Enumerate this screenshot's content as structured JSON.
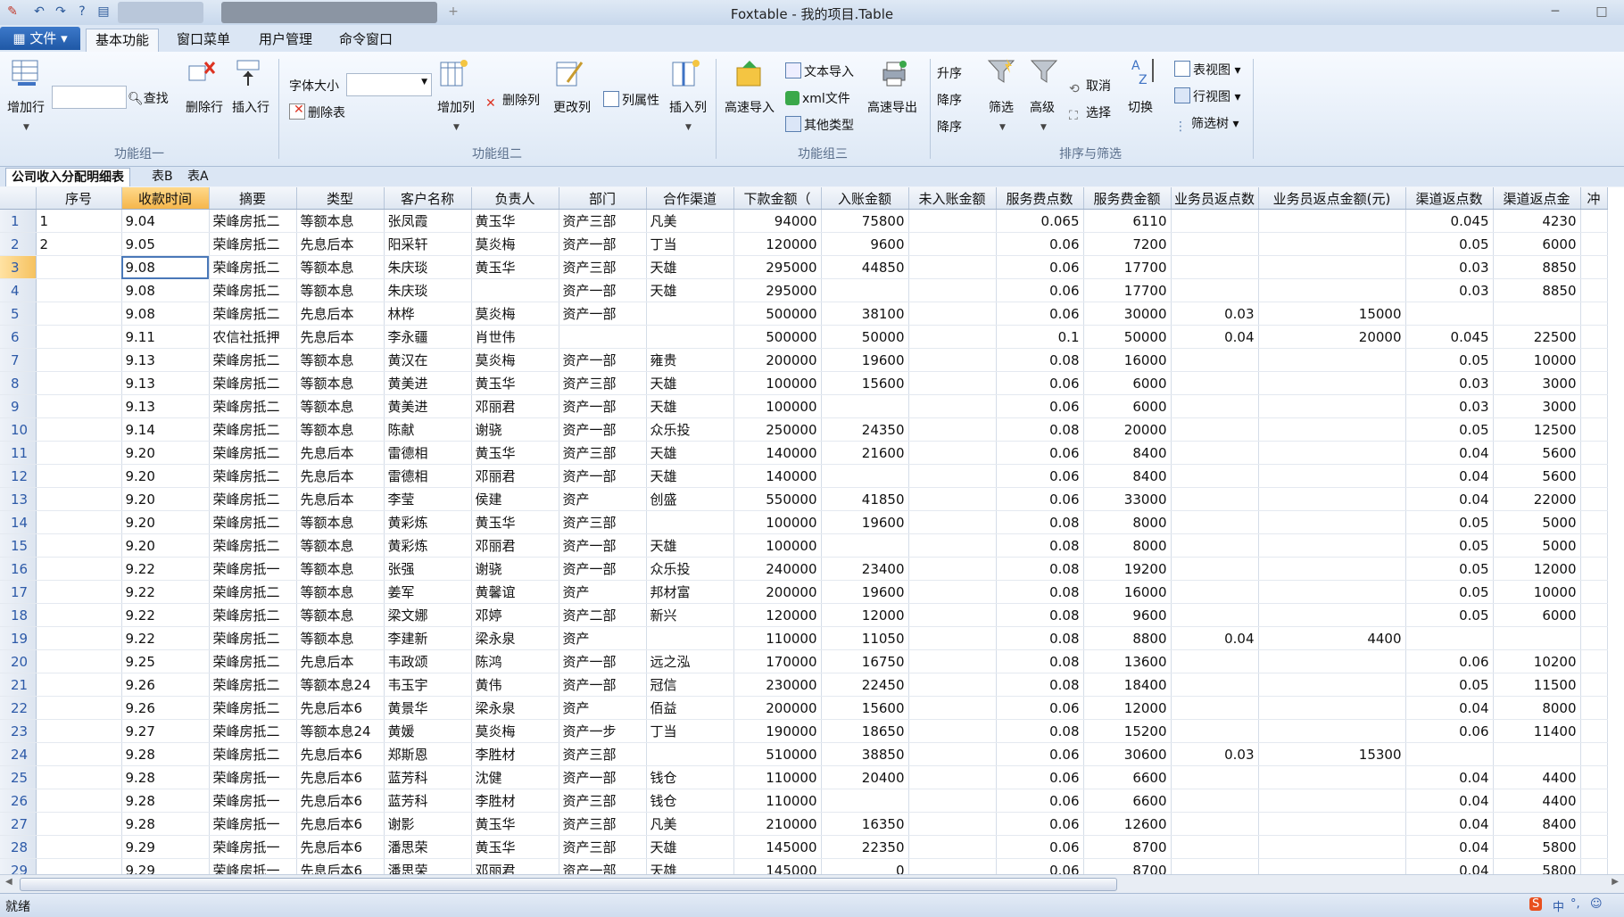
{
  "window": {
    "title": "Foxtable - 我的项目.Table"
  },
  "menu": {
    "file": "文件",
    "tabs": [
      "基本功能",
      "窗口菜单",
      "用户管理",
      "命令窗口"
    ]
  },
  "ribbon": {
    "group1": {
      "label": "功能组一",
      "add_row": "增加行",
      "search": "查找",
      "delete_row": "删除行",
      "insert_row": "插入行"
    },
    "group2": {
      "label": "功能组二",
      "font_size": "字体大小",
      "delete_table": "删除表",
      "add_col": "增加列",
      "delete_col": "删除列",
      "change_col": "更改列",
      "col_props": "列属性",
      "insert_col": "插入列"
    },
    "group3": {
      "label": "功能组三",
      "fast_import": "高速导入",
      "text_import": "文本导入",
      "xml_file": "xml文件",
      "other_types": "其他类型",
      "fast_export": "高速导出"
    },
    "group4": {
      "label": "排序与筛选",
      "asc": "升序",
      "desc1": "降序",
      "desc2": "降序",
      "filter": "筛选",
      "advanced": "高级",
      "cancel": "取消",
      "select": "选择",
      "switch": "切换",
      "table_view": "表视图",
      "row_view": "行视图",
      "filter_tree": "筛选树"
    }
  },
  "sheet_tabs": [
    "公司收入分配明细表",
    "表B",
    "表A"
  ],
  "columns": [
    "序号",
    "收款时间",
    "摘要",
    "类型",
    "客户名称",
    "负责人",
    "部门",
    "合作渠道",
    "下款金额（",
    "入账金额",
    "未入账金额",
    "服务费点数",
    "服务费金额",
    "业务员返点数",
    "业务员返点金额(元)",
    "渠道返点数",
    "渠道返点金",
    "冲"
  ],
  "rows": [
    [
      "1",
      "9.04",
      "荣峰房抵二",
      "等额本息",
      "张凤霞",
      "黄玉华",
      "资产三部",
      "凡美",
      "94000",
      "75800",
      "",
      "0.065",
      "6110",
      "",
      "",
      "0.045",
      "4230",
      ""
    ],
    [
      "2",
      "9.05",
      "荣峰房抵二",
      "先息后本",
      "阳采轩",
      "莫炎梅",
      "资产一部",
      "丁当",
      "120000",
      "9600",
      "",
      "0.06",
      "7200",
      "",
      "",
      "0.05",
      "6000",
      ""
    ],
    [
      "",
      "9.08",
      "荣峰房抵二",
      "等额本息",
      "朱庆琰",
      "黄玉华",
      "资产三部",
      "天雄",
      "295000",
      "44850",
      "",
      "0.06",
      "17700",
      "",
      "",
      "0.03",
      "8850",
      ""
    ],
    [
      "",
      "9.08",
      "荣峰房抵二",
      "等额本息",
      "朱庆琰",
      "",
      "资产一部",
      "天雄",
      "295000",
      "",
      "",
      "0.06",
      "17700",
      "",
      "",
      "0.03",
      "8850",
      ""
    ],
    [
      "",
      "9.08",
      "荣峰房抵二",
      "先息后本",
      "林桦",
      "莫炎梅",
      "资产一部",
      "",
      "500000",
      "38100",
      "",
      "0.06",
      "30000",
      "0.03",
      "15000",
      "",
      "",
      ""
    ],
    [
      "",
      "9.11",
      "农信社抵押",
      "先息后本",
      "李永疆",
      "肖世伟",
      "",
      "",
      "500000",
      "50000",
      "",
      "0.1",
      "50000",
      "0.04",
      "20000",
      "0.045",
      "22500",
      ""
    ],
    [
      "",
      "9.13",
      "荣峰房抵二",
      "等额本息",
      "黄汉在",
      "莫炎梅",
      "资产一部",
      "雍贵",
      "200000",
      "19600",
      "",
      "0.08",
      "16000",
      "",
      "",
      "0.05",
      "10000",
      ""
    ],
    [
      "",
      "9.13",
      "荣峰房抵二",
      "等额本息",
      "黄美进",
      "黄玉华",
      "资产三部",
      "天雄",
      "100000",
      "15600",
      "",
      "0.06",
      "6000",
      "",
      "",
      "0.03",
      "3000",
      ""
    ],
    [
      "",
      "9.13",
      "荣峰房抵二",
      "等额本息",
      "黄美进",
      "邓丽君",
      "资产一部",
      "天雄",
      "100000",
      "",
      "",
      "0.06",
      "6000",
      "",
      "",
      "0.03",
      "3000",
      ""
    ],
    [
      "",
      "9.14",
      "荣峰房抵二",
      "等额本息",
      "陈献",
      "谢骁",
      "资产一部",
      "众乐投",
      "250000",
      "24350",
      "",
      "0.08",
      "20000",
      "",
      "",
      "0.05",
      "12500",
      ""
    ],
    [
      "",
      "9.20",
      "荣峰房抵二",
      "先息后本",
      "雷德相",
      "黄玉华",
      "资产三部",
      "天雄",
      "140000",
      "21600",
      "",
      "0.06",
      "8400",
      "",
      "",
      "0.04",
      "5600",
      ""
    ],
    [
      "",
      "9.20",
      "荣峰房抵二",
      "先息后本",
      "雷德相",
      "邓丽君",
      "资产一部",
      "天雄",
      "140000",
      "",
      "",
      "0.06",
      "8400",
      "",
      "",
      "0.04",
      "5600",
      ""
    ],
    [
      "",
      "9.20",
      "荣峰房抵二",
      "先息后本",
      "李莹",
      "侯建",
      "资产",
      "创盛",
      "550000",
      "41850",
      "",
      "0.06",
      "33000",
      "",
      "",
      "0.04",
      "22000",
      ""
    ],
    [
      "",
      "9.20",
      "荣峰房抵二",
      "等额本息",
      "黄彩炼",
      "黄玉华",
      "资产三部",
      "",
      "100000",
      "19600",
      "",
      "0.08",
      "8000",
      "",
      "",
      "0.05",
      "5000",
      ""
    ],
    [
      "",
      "9.20",
      "荣峰房抵二",
      "等额本息",
      "黄彩炼",
      "邓丽君",
      "资产一部",
      "天雄",
      "100000",
      "",
      "",
      "0.08",
      "8000",
      "",
      "",
      "0.05",
      "5000",
      ""
    ],
    [
      "",
      "9.22",
      "荣峰房抵一",
      "等额本息",
      "张强",
      "谢骁",
      "资产一部",
      "众乐投",
      "240000",
      "23400",
      "",
      "0.08",
      "19200",
      "",
      "",
      "0.05",
      "12000",
      ""
    ],
    [
      "",
      "9.22",
      "荣峰房抵二",
      "等额本息",
      "姜军",
      "黄馨谊",
      "资产",
      "邦材富",
      "200000",
      "19600",
      "",
      "0.08",
      "16000",
      "",
      "",
      "0.05",
      "10000",
      ""
    ],
    [
      "",
      "9.22",
      "荣峰房抵二",
      "等额本息",
      "梁文娜",
      "邓婷",
      "资产二部",
      "新兴",
      "120000",
      "12000",
      "",
      "0.08",
      "9600",
      "",
      "",
      "0.05",
      "6000",
      ""
    ],
    [
      "",
      "9.22",
      "荣峰房抵二",
      "等额本息",
      "李建新",
      "梁永泉",
      "资产",
      "",
      "110000",
      "11050",
      "",
      "0.08",
      "8800",
      "0.04",
      "4400",
      "",
      "",
      ""
    ],
    [
      "",
      "9.25",
      "荣峰房抵二",
      "先息后本",
      "韦政颂",
      "陈鸿",
      "资产一部",
      "远之泓",
      "170000",
      "16750",
      "",
      "0.08",
      "13600",
      "",
      "",
      "0.06",
      "10200",
      ""
    ],
    [
      "",
      "9.26",
      "荣峰房抵二",
      "等额本息24",
      "韦玉宇",
      "黄伟",
      "资产一部",
      "冠信",
      "230000",
      "22450",
      "",
      "0.08",
      "18400",
      "",
      "",
      "0.05",
      "11500",
      ""
    ],
    [
      "",
      "9.26",
      "荣峰房抵二",
      "先息后本6",
      "黄景华",
      "梁永泉",
      "资产",
      "佰益",
      "200000",
      "15600",
      "",
      "0.06",
      "12000",
      "",
      "",
      "0.04",
      "8000",
      ""
    ],
    [
      "",
      "9.27",
      "荣峰房抵二",
      "等额本息24",
      "黄媛",
      "莫炎梅",
      "资产一步",
      "丁当",
      "190000",
      "18650",
      "",
      "0.08",
      "15200",
      "",
      "",
      "0.06",
      "11400",
      ""
    ],
    [
      "",
      "9.28",
      "荣峰房抵二",
      "先息后本6",
      "郑斯恩",
      "李胜材",
      "资产三部",
      "",
      "510000",
      "38850",
      "",
      "0.06",
      "30600",
      "0.03",
      "15300",
      "",
      "",
      ""
    ],
    [
      "",
      "9.28",
      "荣峰房抵一",
      "先息后本6",
      "蓝芳科",
      "沈健",
      "资产一部",
      "钱仓",
      "110000",
      "20400",
      "",
      "0.06",
      "6600",
      "",
      "",
      "0.04",
      "4400",
      ""
    ],
    [
      "",
      "9.28",
      "荣峰房抵一",
      "先息后本6",
      "蓝芳科",
      "李胜材",
      "资产三部",
      "钱仓",
      "110000",
      "",
      "",
      "0.06",
      "6600",
      "",
      "",
      "0.04",
      "4400",
      ""
    ],
    [
      "",
      "9.28",
      "荣峰房抵一",
      "先息后本6",
      "谢影",
      "黄玉华",
      "资产三部",
      "凡美",
      "210000",
      "16350",
      "",
      "0.06",
      "12600",
      "",
      "",
      "0.04",
      "8400",
      ""
    ],
    [
      "",
      "9.29",
      "荣峰房抵一",
      "先息后本6",
      "潘思荣",
      "黄玉华",
      "资产三部",
      "天雄",
      "145000",
      "22350",
      "",
      "0.06",
      "8700",
      "",
      "",
      "0.04",
      "5800",
      ""
    ],
    [
      "",
      "9.29",
      "荣峰房抵一",
      "先息后本6",
      "潘思荣",
      "邓丽君",
      "资产一部",
      "天雄",
      "145000",
      "0",
      "",
      "0.06",
      "8700",
      "",
      "",
      "0.04",
      "5800",
      ""
    ]
  ],
  "status": {
    "text": "就绪",
    "ime": "中"
  },
  "colors": {
    "accent": "#1f58a6",
    "selection": "#f5b64c"
  }
}
